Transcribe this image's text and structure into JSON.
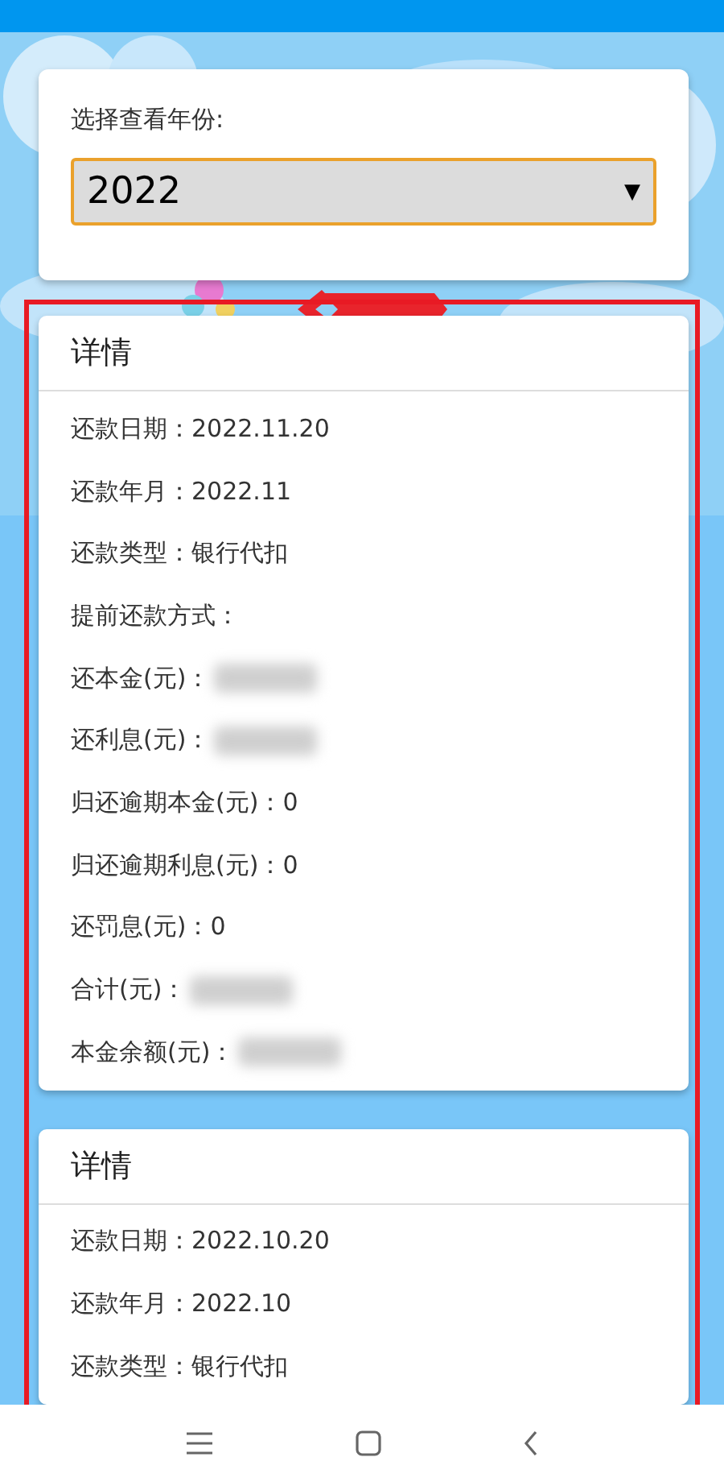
{
  "year_picker": {
    "label": "选择查看年份:",
    "value": "2022",
    "arrow": "▼"
  },
  "details": [
    {
      "title": "详情",
      "rows": [
        {
          "label": "还款日期：",
          "value": "2022.11.20",
          "blurred": false
        },
        {
          "label": "还款年月：",
          "value": "2022.11",
          "blurred": false
        },
        {
          "label": "还款类型：",
          "value": "银行代扣",
          "blurred": false
        },
        {
          "label": "提前还款方式：",
          "blurred": false
        },
        {
          "label": "还本金(元)：",
          "blurred": true
        },
        {
          "label": "还利息(元)：",
          "blurred": true
        },
        {
          "label": "归还逾期本金(元)：",
          "value": "0",
          "blurred": false
        },
        {
          "label": "归还逾期利息(元)：",
          "value": "0",
          "blurred": false
        },
        {
          "label": "还罚息(元)：",
          "value": "0",
          "blurred": false
        },
        {
          "label": "合计(元)：",
          "blurred": true
        },
        {
          "label": "本金余额(元)：",
          "blurred": true
        }
      ]
    },
    {
      "title": "详情",
      "rows": [
        {
          "label": "还款日期：",
          "value": "2022.10.20",
          "blurred": false
        },
        {
          "label": "还款年月：",
          "value": "2022.10",
          "blurred": false
        },
        {
          "label": "还款类型：",
          "value": "银行代扣",
          "blurred": false
        }
      ]
    }
  ]
}
